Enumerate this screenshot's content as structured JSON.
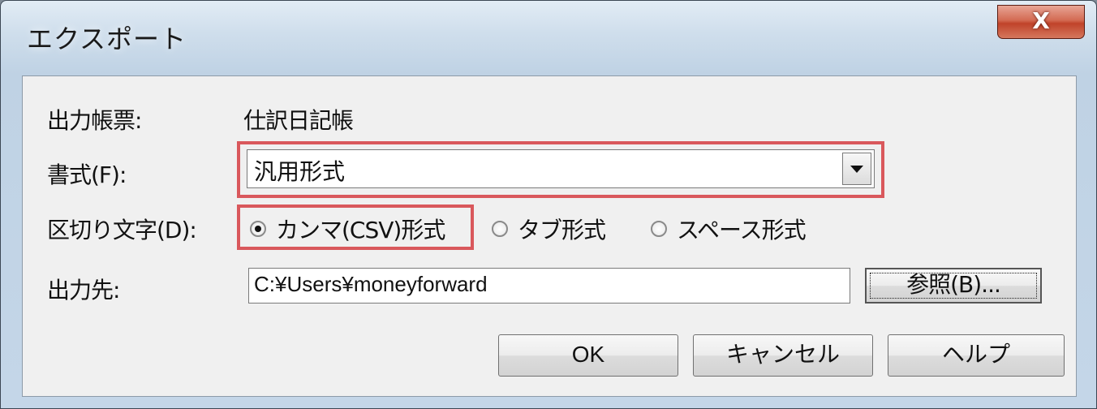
{
  "window": {
    "title": "エクスポート",
    "close_label": "X"
  },
  "form": {
    "report_label": "出力帳票:",
    "report_value": "仕訳日記帳",
    "format_label": "書式(F):",
    "format_value": "汎用形式",
    "delimiter_label": "区切り文字(D):",
    "delimiter_options": [
      {
        "label": "カンマ(CSV)形式",
        "checked": true
      },
      {
        "label": "タブ形式",
        "checked": false
      },
      {
        "label": "スペース形式",
        "checked": false
      }
    ],
    "output_label": "出力先:",
    "output_value": "C:¥Users¥moneyforward",
    "browse_label": "参照(B)..."
  },
  "buttons": {
    "ok": "OK",
    "cancel": "キャンセル",
    "help": "ヘルプ"
  },
  "colors": {
    "highlight": "#d9585c",
    "close_button": "#c0432a"
  }
}
